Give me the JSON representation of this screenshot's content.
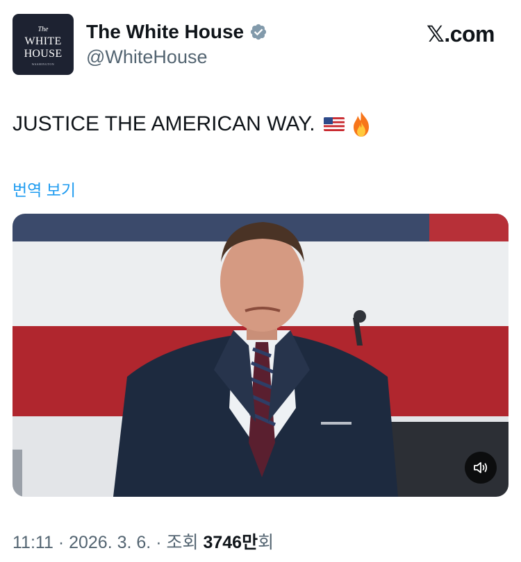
{
  "header": {
    "logo": {
      "line_the": "The",
      "line1": "WHITE",
      "line2": "HOUSE",
      "line3": "WASHINGTON"
    },
    "name": "The White House",
    "verified_icon": "verified-badge-icon",
    "handle": "@WhiteHouse",
    "site": "𝕏.com"
  },
  "tweet": {
    "text": "JUSTICE THE AMERICAN WAY.",
    "emojis": [
      "us-flag-icon",
      "fire-icon"
    ],
    "translate_label": "번역 보기"
  },
  "media": {
    "type": "video",
    "sound_icon": "speaker-icon"
  },
  "meta": {
    "time": "11:11",
    "separator": "·",
    "date": "2026. 3. 6.",
    "views_prefix": "조회",
    "views_count": "3746만",
    "views_suffix": "회"
  },
  "colors": {
    "link": "#1d9bf0",
    "verified": "#829aab",
    "logo_bg": "#1d2231",
    "flag_red": "#b0262e",
    "flag_blue": "#3b4a6b"
  }
}
